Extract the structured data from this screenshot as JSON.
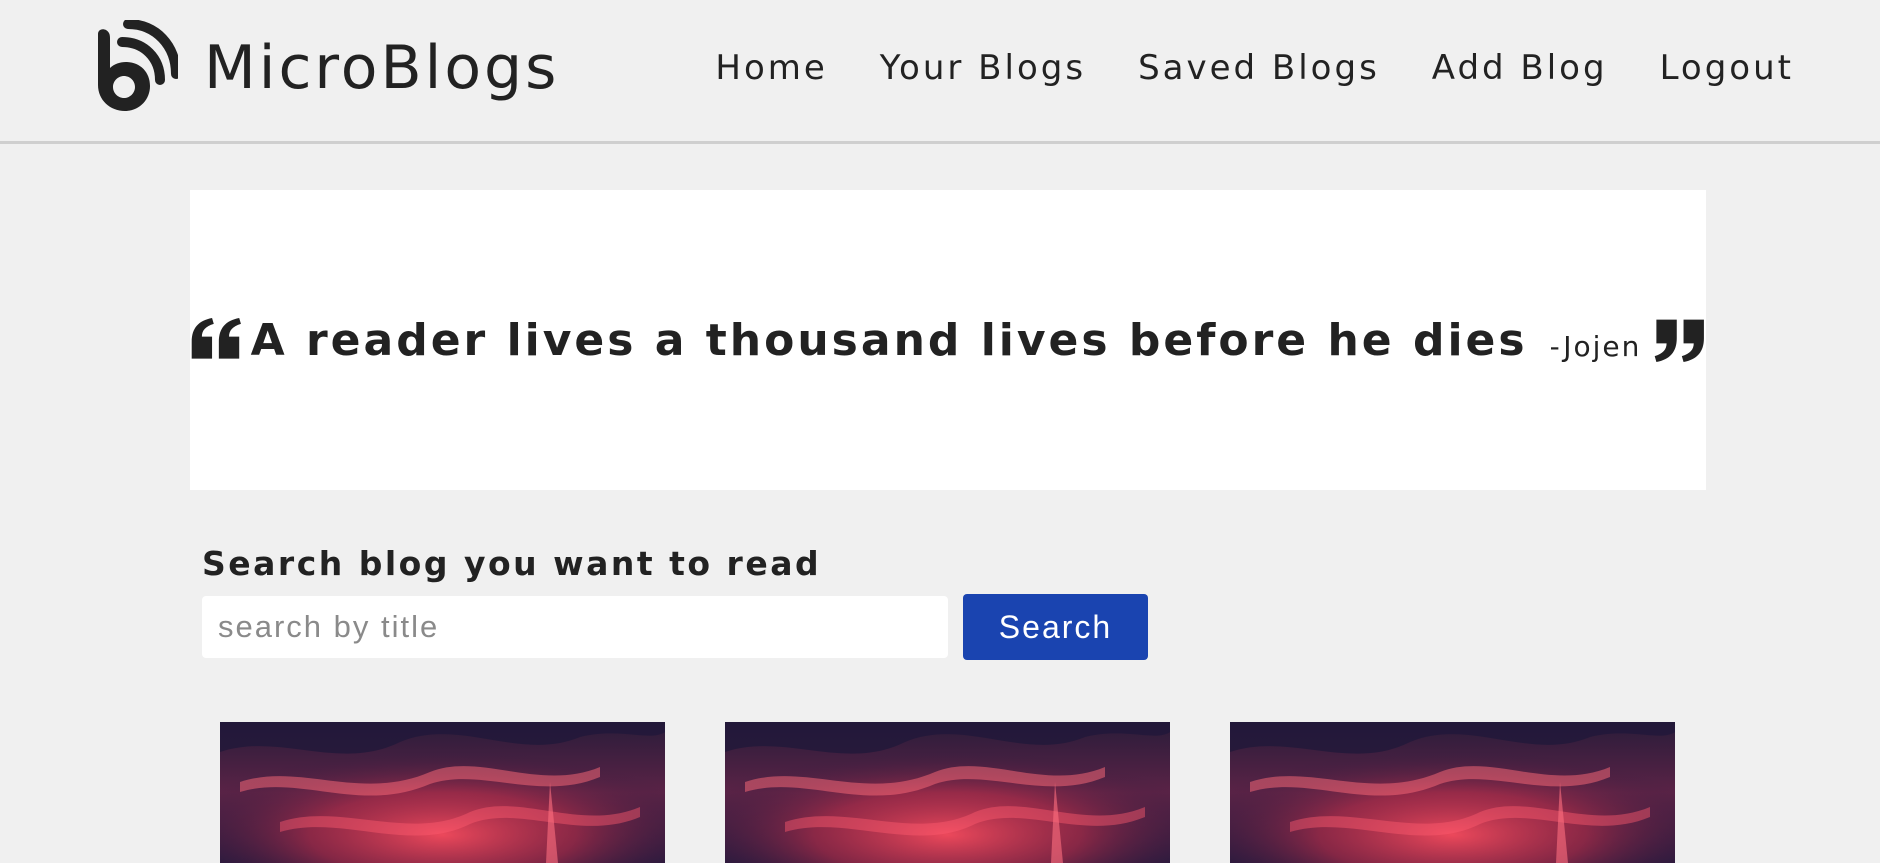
{
  "header": {
    "brand_name": "MicroBlogs",
    "nav": [
      {
        "label": "Home"
      },
      {
        "label": "Your Blogs"
      },
      {
        "label": "Saved Blogs"
      },
      {
        "label": "Add Blog"
      },
      {
        "label": "Logout"
      }
    ]
  },
  "quote": {
    "text": "A reader lives a thousand lives before he dies",
    "author": "-Jojen"
  },
  "search": {
    "heading": "Search blog you want to read",
    "placeholder": "search by title",
    "button_label": "Search"
  },
  "cards": [
    {
      "image": "red-sky-image"
    },
    {
      "image": "red-sky-image"
    },
    {
      "image": "red-sky-image"
    }
  ],
  "colors": {
    "background": "#f0f0f0",
    "text": "#222222",
    "accent": "#1a44b0",
    "panel": "#ffffff"
  }
}
